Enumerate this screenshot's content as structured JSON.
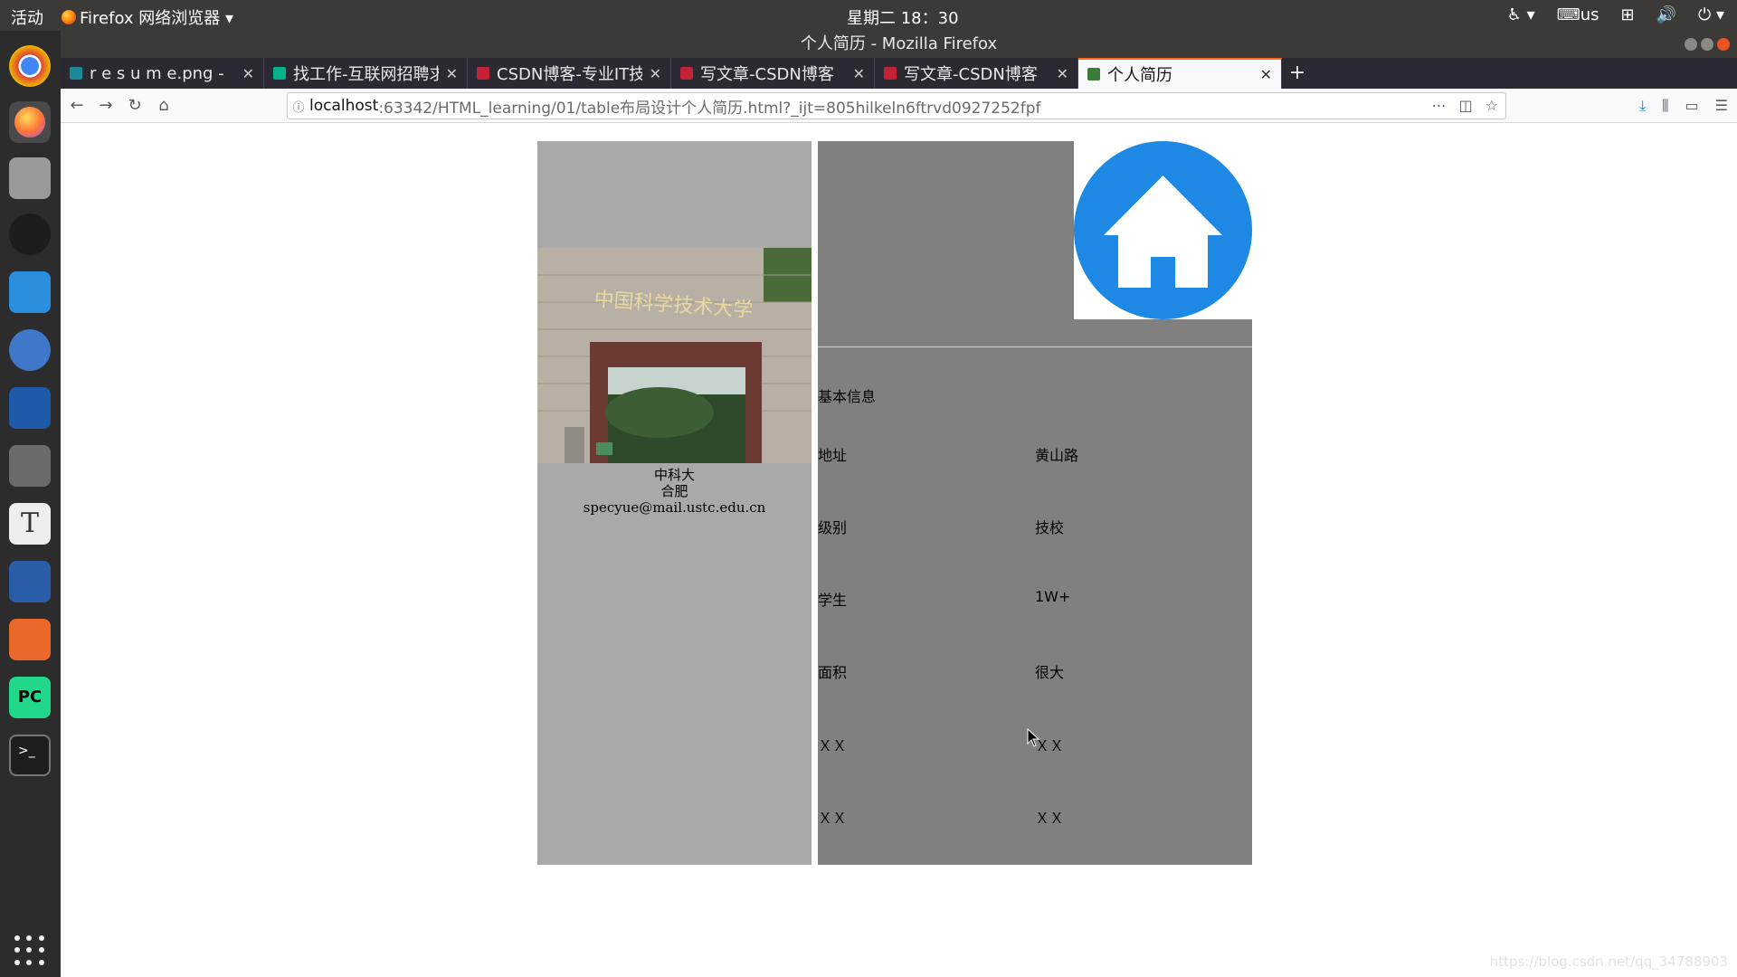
{
  "system_bar": {
    "activities": "活动",
    "app_menu": "Firefox 网络浏览器 ▾",
    "clock": "星期二 18：30",
    "keyboard": "us"
  },
  "window": {
    "title": "个人简历 - Mozilla Firefox"
  },
  "tabs": [
    {
      "label": "r e s u m e.png -",
      "favicon_color": "#1a8a96"
    },
    {
      "label": "找工作-互联网招聘求",
      "favicon_color": "#00b38a"
    },
    {
      "label": "CSDN博客-专业IT技",
      "favicon_color": "#c32136"
    },
    {
      "label": "写文章-CSDN博客",
      "favicon_color": "#c32136"
    },
    {
      "label": "写文章-CSDN博客",
      "favicon_color": "#c32136"
    },
    {
      "label": "个人简历",
      "favicon_color": "#3a7d3a"
    }
  ],
  "url": {
    "host": "localhost",
    "path": ":63342/HTML_learning/01/table布局设计个人简历.html?_ijt=805hilkeln6ftrvd0927252fpf"
  },
  "resume": {
    "school": "中科大",
    "city": "合肥",
    "email": "specyue@mail.ustc.edu.cn",
    "section_title": "基本信息",
    "rows": [
      {
        "label": "地址",
        "value": "黄山路"
      },
      {
        "label": "级别",
        "value": "技校"
      },
      {
        "label": "学生",
        "value": "1W+"
      },
      {
        "label": "面积",
        "value": "很大"
      },
      {
        "label": "ＸＸ",
        "value": "ＸＸ"
      },
      {
        "label": "ＸＸ",
        "value": "ＸＸ"
      }
    ],
    "gate_sign": "中国科学技术大学"
  },
  "watermark": "https://blog.csdn.net/qq_34788903"
}
